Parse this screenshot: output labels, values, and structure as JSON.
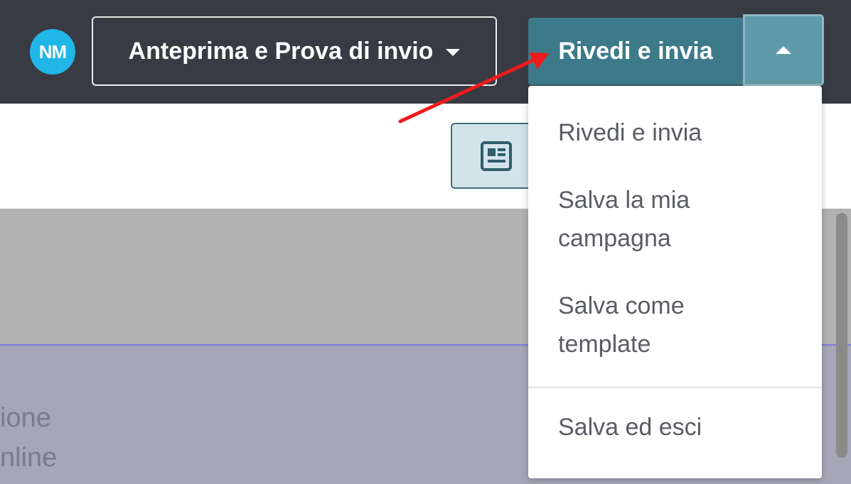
{
  "header": {
    "avatar_initials": "NM",
    "preview_label": "Anteprima e Prova di invio",
    "review_label": "Rivedi e invia"
  },
  "dropdown": {
    "items": [
      {
        "line1": "Rivedi e invia",
        "line2": ""
      },
      {
        "line1": "Salva la mia",
        "line2": "campagna"
      },
      {
        "line1": "Salva come",
        "line2": "template"
      },
      {
        "line1": "Salva ed esci",
        "line2": ""
      }
    ]
  },
  "background_text": {
    "fragment1": "ione",
    "fragment2": "nline"
  },
  "colors": {
    "topbar": "#383b44",
    "avatar": "#20b6e8",
    "review_button": "#3d7a89",
    "toggle_button": "#5f9aa8",
    "annotation_arrow": "#ee1c1c"
  },
  "icons": {
    "preview_caret": "chevron-down-icon",
    "toggle_caret": "chevron-up-icon",
    "doc_button": "newspaper-icon"
  }
}
